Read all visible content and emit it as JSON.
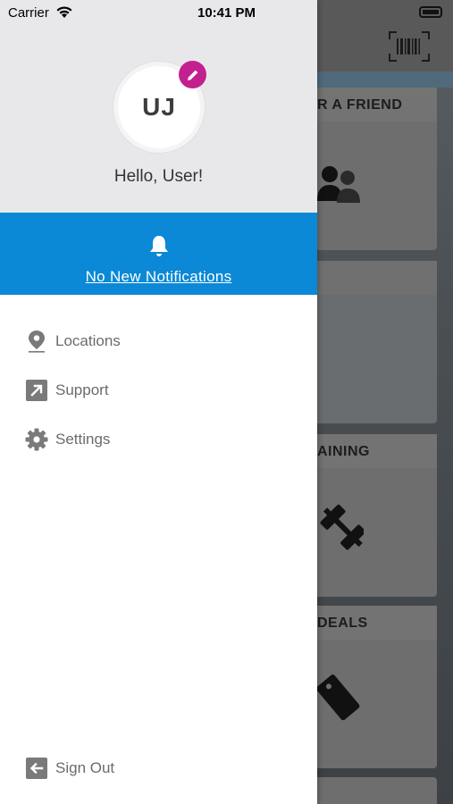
{
  "status_bar": {
    "carrier": "Carrier",
    "time": "10:41 PM"
  },
  "profile": {
    "initials": "UJ",
    "greeting": "Hello, User!"
  },
  "notifications": {
    "text": "No New Notifications"
  },
  "menu": [
    {
      "label": "Locations",
      "icon": "location-pin-icon"
    },
    {
      "label": "Support",
      "icon": "external-link-icon"
    },
    {
      "label": "Settings",
      "icon": "gear-icon"
    }
  ],
  "sign_out": {
    "label": "Sign Out",
    "icon": "sign-out-icon"
  },
  "background_cards": [
    {
      "title": "R A FRIEND"
    },
    {
      "title": ""
    },
    {
      "title": "AINING"
    },
    {
      "title": "DEALS"
    }
  ],
  "colors": {
    "accent_blue": "#0b88d6",
    "edit_badge": "#c41f8f",
    "drawer_header_bg": "#e8e8ea"
  }
}
